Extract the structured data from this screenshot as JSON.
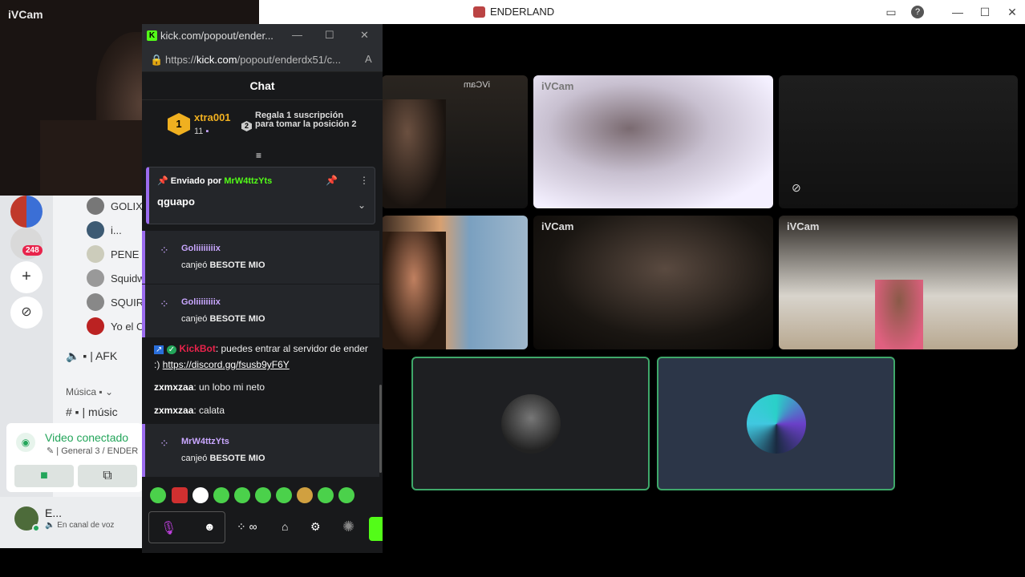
{
  "window": {
    "title": "ENDERLAND",
    "controls": {
      "minimize": "—",
      "maximize": "☐",
      "close": "✕"
    }
  },
  "self_camera": {
    "label": "iVCam"
  },
  "servers": {
    "badge": "248"
  },
  "channels": {
    "members": [
      "GOLIX",
      "i...",
      "PENE C",
      "Squidw",
      "SQUIRT",
      "Yo el C"
    ],
    "afk": "| AFK",
    "category": "Música",
    "music_channel": "| músic"
  },
  "voice_connection": {
    "status": "Video conectado",
    "channel": "| General 3 / ENDER"
  },
  "user": {
    "name": "E...",
    "status": "En canal de voz"
  },
  "kick": {
    "tab_title": "kick.com/popout/ender...",
    "url_prefix": "https://",
    "url_host": "kick.com",
    "url_path": "/popout/enderdx51/c...",
    "chat_header": "Chat",
    "top_gifter": {
      "rank": "1",
      "name": "xtra001",
      "count": "11"
    },
    "gift_prompt": {
      "rank": "2",
      "text": "Regala 1 suscripción para tomar la posición 2"
    },
    "pinned": {
      "prefix": "Enviado por",
      "author": "MrW4ttzYts",
      "message": "qguapo"
    },
    "redeems": [
      {
        "user": "Goliiiiiiiix",
        "action": "canjeó",
        "reward": "BESOTE MIO"
      },
      {
        "user": "Goliiiiiiiix",
        "action": "canjeó",
        "reward": "BESOTE MIO"
      },
      {
        "user": "MrW4ttzYts",
        "action": "canjeó",
        "reward": "BESOTE MIO"
      }
    ],
    "messages": [
      {
        "nick": "KickBot",
        "text": ": puedes entrar al servidor de ender :) ",
        "link": "https://discord.gg/fsusb9yF6Y"
      },
      {
        "nick": "zxmxzaa",
        "text": ": un lobo mi neto"
      },
      {
        "nick": "zxmxzaa",
        "text": ": calata"
      }
    ],
    "input_icons": [
      "mic-icon",
      "emoji-icon"
    ],
    "infinity": "∞"
  },
  "video_tiles": [
    {
      "label": "iVCam"
    },
    {
      "label": "iVCam"
    },
    {
      "label": "iVCam"
    }
  ],
  "mirrored_label": "iVCam",
  "colors": {
    "kick_green": "#53fc18",
    "voice_border": "#3fa86a",
    "redeem_purple": "#9b6cf0",
    "kickbot_red": "#e8234b",
    "pinned_author": "#53fc18"
  }
}
